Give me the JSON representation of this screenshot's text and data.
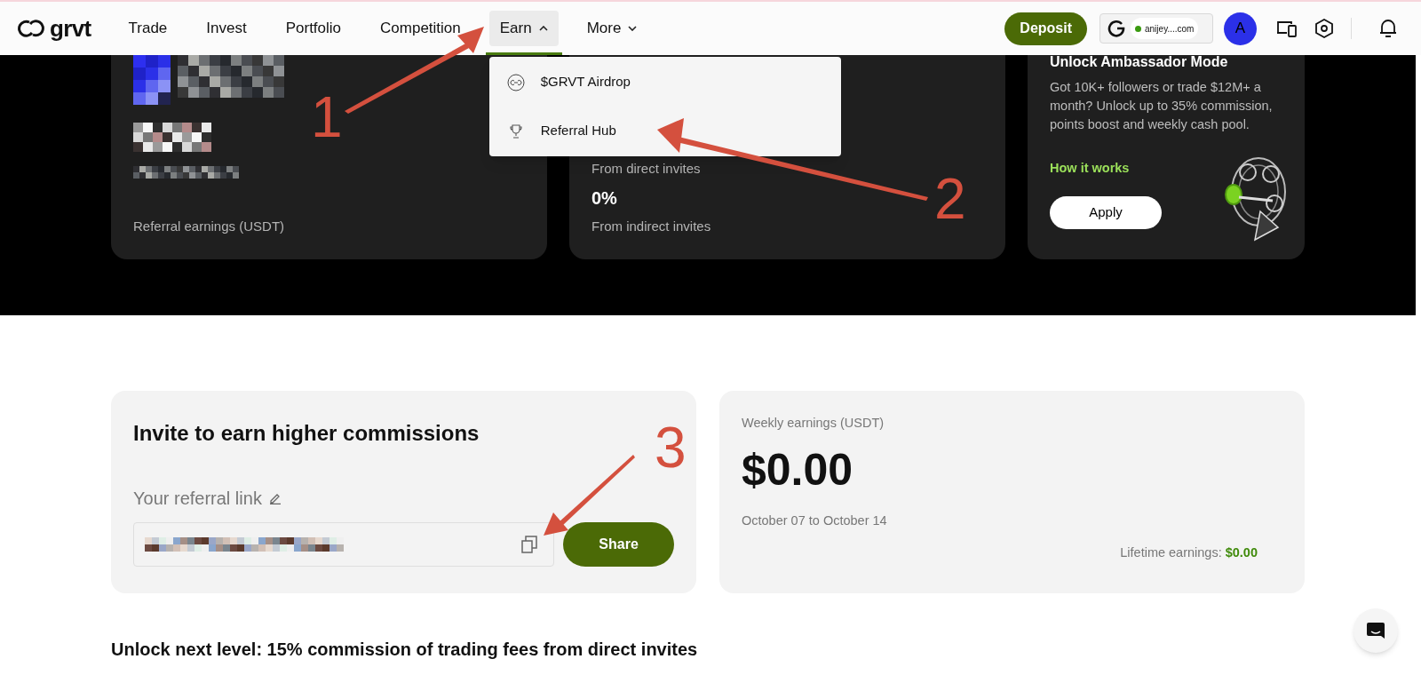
{
  "header": {
    "logo": "grvt",
    "nav": [
      {
        "label": "Trade",
        "kind": "link",
        "selected": false
      },
      {
        "label": "Invest",
        "kind": "link",
        "selected": false
      },
      {
        "label": "Portfolio",
        "kind": "link",
        "selected": false
      },
      {
        "label": "Competition",
        "kind": "link",
        "selected": false
      },
      {
        "label": "Earn",
        "kind": "menu",
        "selected": true,
        "expanded": true
      },
      {
        "label": "More",
        "kind": "menu",
        "selected": false,
        "expanded": false
      }
    ],
    "deposit": "Deposit",
    "wallet": {
      "address": "anijey....com",
      "connected": true
    },
    "avatar": "A"
  },
  "earn_menu": [
    {
      "label": "$GRVT Airdrop",
      "kind": "airdrop"
    },
    {
      "label": "Referral Hub",
      "kind": "trophy"
    }
  ],
  "overview": {
    "earnings_label": "Referral earnings (USDT)",
    "direct_label": "From direct invites",
    "indirect_value": "0%",
    "indirect_label": "From indirect invites",
    "ambassador": {
      "title": "Unlock Ambassador Mode",
      "text": "Got 10K+ followers or trade $12M+ a month? Unlock up to 35% commission, points boost and weekly cash pool.",
      "link": "How it works",
      "button": "Apply"
    }
  },
  "invite": {
    "title": "Invite to earn higher commissions",
    "link_label": "Your referral link",
    "share": "Share"
  },
  "weekly": {
    "label": "Weekly earnings (USDT)",
    "amount": "$0.00",
    "period": "October 07 to October 14",
    "lifetime_label": "Lifetime earnings:",
    "lifetime_value": "$0.00"
  },
  "next_level": "Unlock next level: 15% commission of trading fees from direct invites",
  "annotations": [
    {
      "label": "1"
    },
    {
      "label": "2"
    },
    {
      "label": "3"
    }
  ]
}
